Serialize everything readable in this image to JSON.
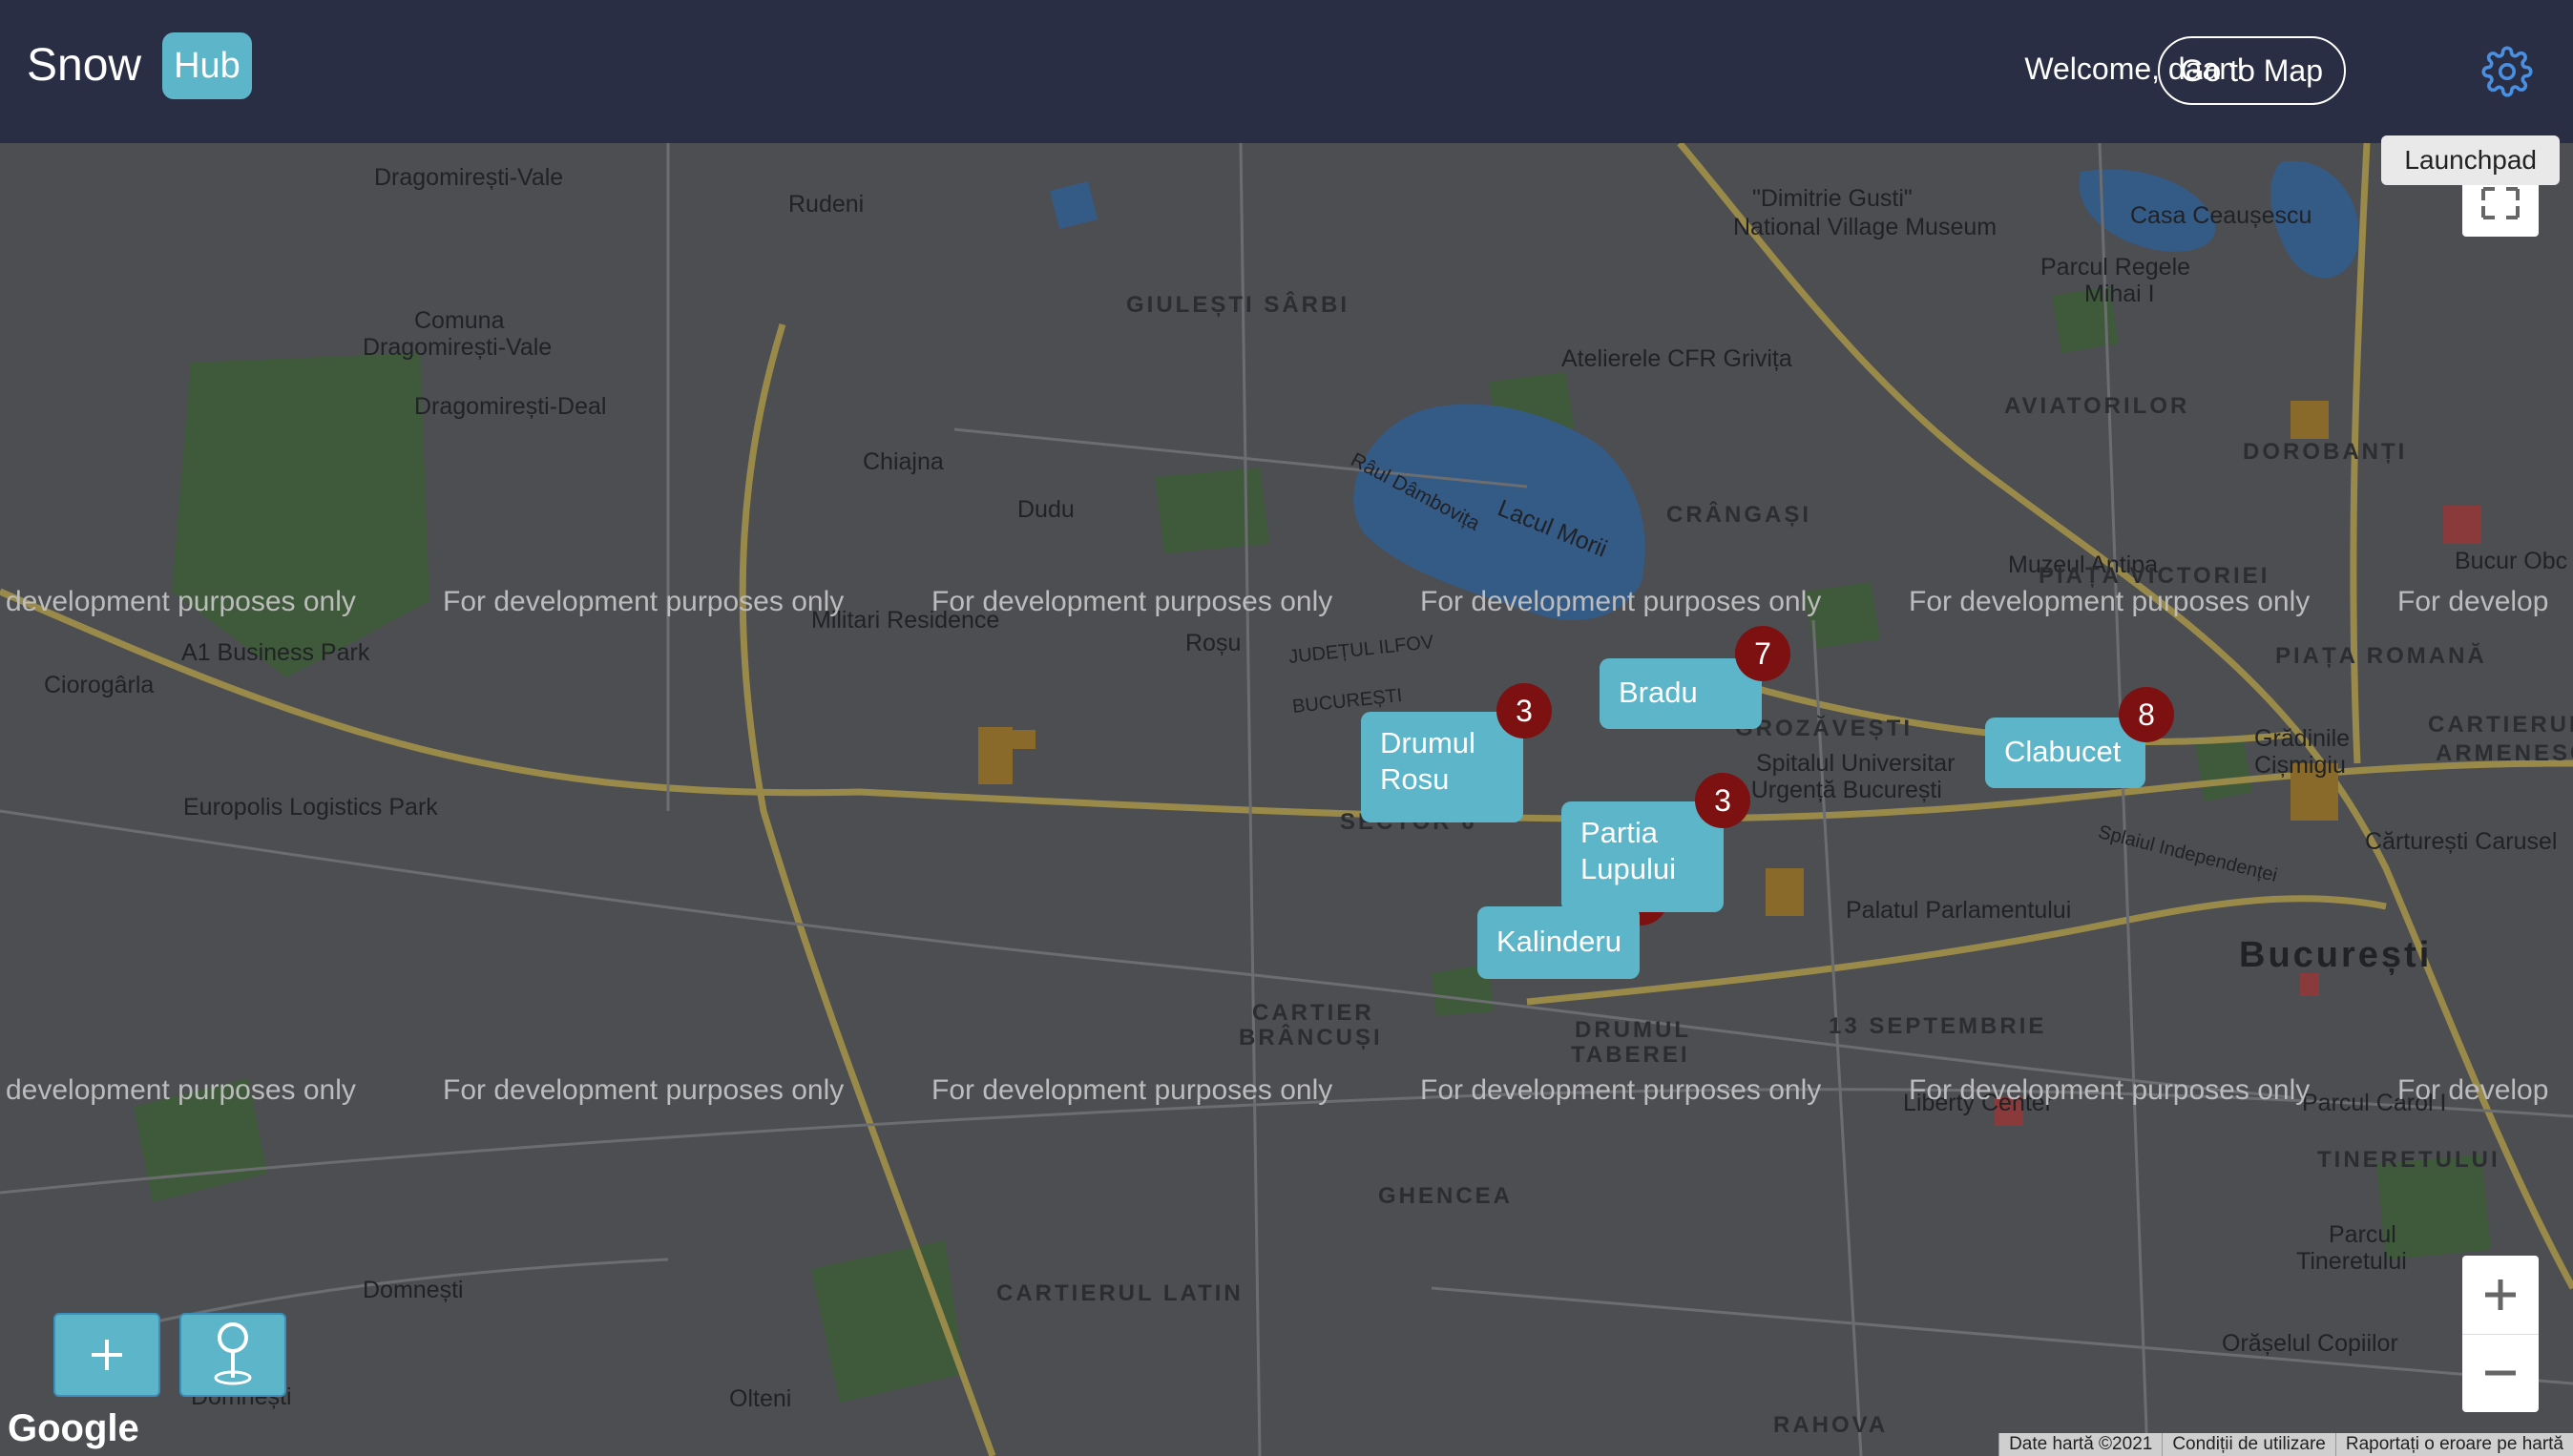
{
  "header": {
    "brand_snow": "Snow",
    "brand_hub": "Hub",
    "welcome": "Welcome, daan!",
    "goto_label": "Go to Map",
    "tooltip": "Launchpad"
  },
  "colors": {
    "header_bg": "#2a2e44",
    "accent": "#5cb5c9",
    "badge": "#7d1111"
  },
  "icons": [
    "gear-icon",
    "fullscreen-icon",
    "plus-icon",
    "map-pin-icon"
  ],
  "dev_notice": "For development purposes only",
  "dev_notice_cut_left": "development purposes only",
  "dev_notice_cut_right": "For develop",
  "resorts": [
    {
      "name": "Bradu",
      "count": "7"
    },
    {
      "name": "Drumul Rosu",
      "count": "3"
    },
    {
      "name": "Clabucet",
      "count": "8"
    },
    {
      "name": "Partia Lupului",
      "count": "3"
    },
    {
      "name": "Kalinderu",
      "count": ""
    }
  ],
  "map_labels": {
    "dragomiresti_vale": "Dragomirești-Vale",
    "rudeni": "Rudeni",
    "comuna1": "Comuna",
    "comuna2": "Dragomirești-Vale",
    "dragomiresti_deal": "Dragomirești-Deal",
    "chiajna": "Chiajna",
    "dudu": "Dudu",
    "giulesti": "GIULEȘTI SÂRBI",
    "atelierele": "Atelierele CFR Grivița",
    "national_village1": "\"Dimitrie Gusti\"",
    "national_village2": "National Village Museum",
    "casa": "Casa Ceaușescu",
    "parcul_regele1": "Parcul Regele",
    "parcul_regele2": "Mihai I",
    "aviatorilor": "AVIATORILOR",
    "dorobanti": "DOROBANȚI",
    "crangasi": "CRÂNGAȘI",
    "muzeul": "Muzeul Antipa",
    "lacul": "Lacul Morii",
    "raul": "Râul Dâmbovița",
    "militari": "Militari Residence",
    "rosu": "Roșu",
    "a1": "A1 Business Park",
    "ciorogarla": "Ciorogârla",
    "europolis": "Europolis Logistics Park",
    "piata_victoriei": "PIAȚA VICTORIEI",
    "piata_romana": "PIAȚA ROMANĂ",
    "bucur_obc": "Bucur Obc",
    "grozavesti": "GROZĂVEȘTI",
    "spital1": "Spitalul Universitar",
    "spital2": "de Urgență București",
    "gradinile1": "Grădinile",
    "gradinile2": "Cișmigiu",
    "cartierul_armenesc1": "CARTIERUL",
    "cartierul_armenesc2": "ARMENESC",
    "carturesti": "Cărturești Carusel",
    "palatul": "Palatul Parlamentului",
    "bucuresti": "București",
    "sector6": "SECTOR 6",
    "cartier_brancusi1": "CARTIER",
    "cartier_brancusi2": "BRÂNCUȘI",
    "drumul_taberei1": "DRUMUL",
    "drumul_taberei2": "TABEREI",
    "13sept": "13 SEPTEMBRIE",
    "liberty": "Liberty Center",
    "parcul_carol": "Parcul Carol I",
    "tineretului": "TINERETULUI",
    "parcul_tineretului1": "Parcul",
    "parcul_tineretului2": "Tineretului",
    "orasel": "Orășelul Copiilor",
    "ghencea": "GHENCEA",
    "cartierul_latin": "CARTIERUL LATIN",
    "domnesti": "Domnești",
    "domnesti2": "Domnești",
    "olteni": "Olteni",
    "rahova": "RAHOVA",
    "judetul_ilfov": "JUDEȚUL ILFOV",
    "bucuresti_small": "BUCUREȘTI",
    "splaiul": "Splaiul Independenței"
  },
  "map_footer": {
    "google": "Google",
    "data": "Date hartă ©2021",
    "terms": "Condiții de utilizare",
    "report": "Raportați o eroare pe hartă"
  }
}
